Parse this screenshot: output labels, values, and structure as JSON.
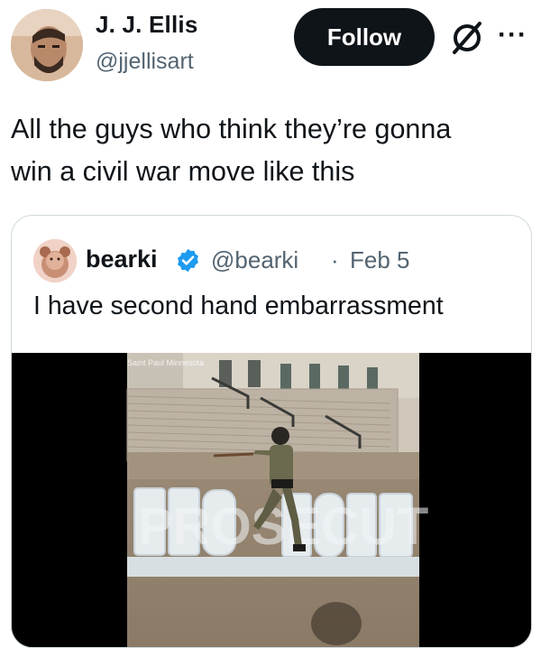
{
  "author": {
    "display_name": "J. J. Ellis",
    "handle": "@jjellisart",
    "avatar_icon": "avatar-photo"
  },
  "actions": {
    "follow_label": "Follow",
    "grok_icon": "grok-icon",
    "more_icon": "more-icon",
    "more_glyph": "···"
  },
  "tweet": {
    "line1": "All the guys who think they’re gonna",
    "line2": "win a civil war move like this"
  },
  "quote": {
    "display_name": "bearki",
    "verified_icon": "verified-badge-icon",
    "handle": "@bearki",
    "separator": "·",
    "date": "Feb 5",
    "text": "I have second hand embarrassment",
    "video": {
      "location_tag": "Saint Paul Minnesota",
      "sign_text": "PROSECUT"
    }
  },
  "colors": {
    "text_primary": "#0f1419",
    "text_secondary": "#536471",
    "follow_bg": "#0f1419",
    "verified_blue": "#1d9bf0",
    "card_border": "#cfd9de"
  }
}
